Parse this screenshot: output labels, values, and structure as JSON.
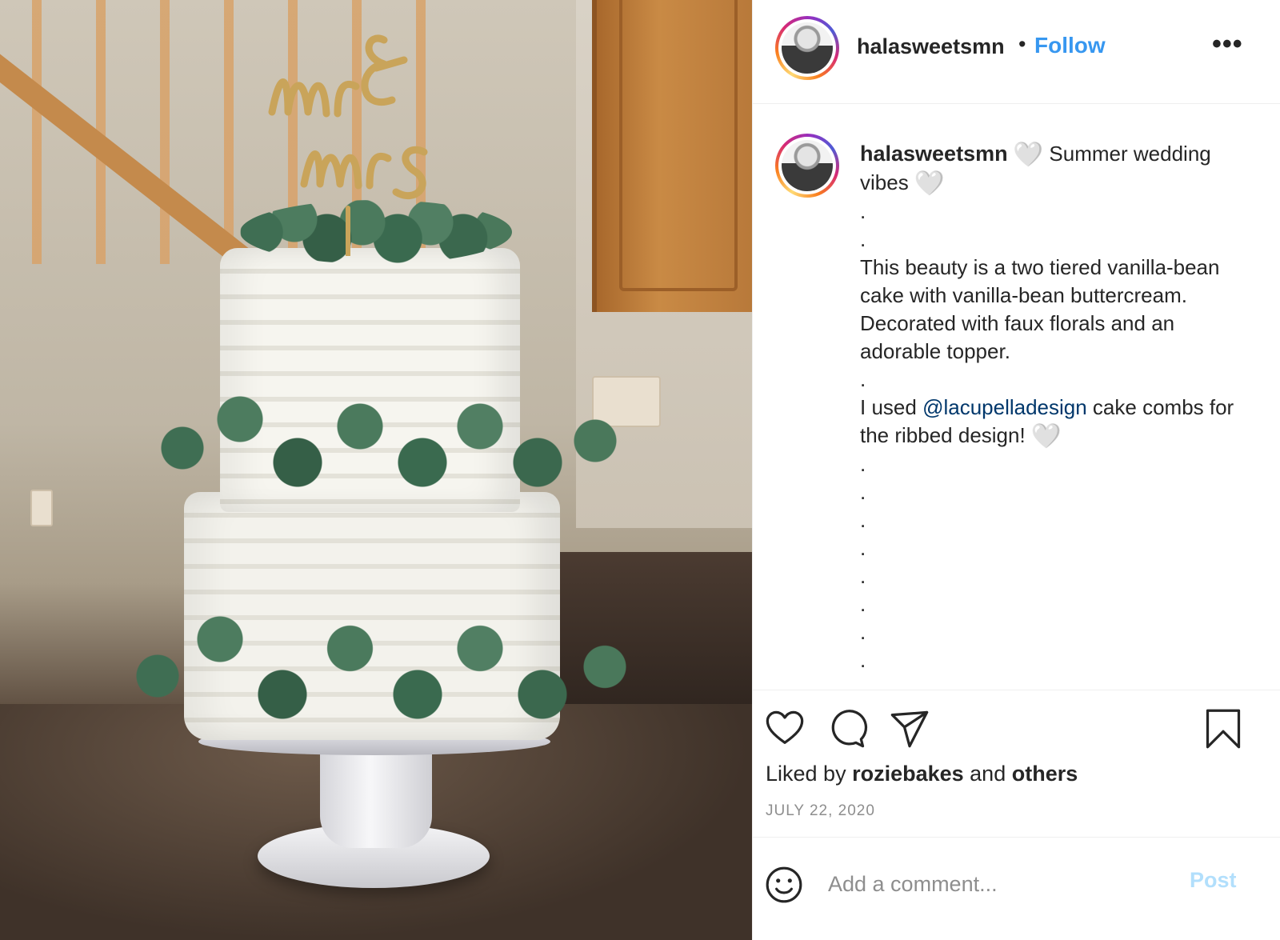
{
  "post": {
    "username": "halasweetsmn",
    "follow_label": "Follow",
    "separator": "•",
    "more_label": "•••"
  },
  "caption": {
    "username": "halasweetsmn",
    "heart": "🤍",
    "line1": "Summer wedding vibes",
    "dots_a": [
      ".",
      "."
    ],
    "paragraph1": "This beauty is a two tiered vanilla-bean cake with vanilla-bean buttercream. Decorated with faux florals and an adorable topper.",
    "dot_b": ".",
    "p2_before": "I used ",
    "mention": "@lacupelladesign",
    "p2_after": " cake combs for the ribbed design!",
    "dots_c": [
      ".",
      ".",
      ".",
      ".",
      ".",
      ".",
      ".",
      "."
    ]
  },
  "actions": {
    "icons": [
      "heart-icon",
      "comment-icon",
      "share-icon",
      "bookmark-icon"
    ]
  },
  "likes": {
    "prefix": "Liked by ",
    "user": "roziebakes",
    "middle": " and ",
    "others": "others"
  },
  "date": "JULY 22, 2020",
  "comment": {
    "placeholder": "Add a comment...",
    "post_label": "Post"
  },
  "colors": {
    "follow": "#3797f0",
    "mention": "#00376b",
    "post_disabled": "#b2dffc",
    "muted": "#8e8e8e"
  },
  "photo": {
    "topper_text": "Mr & Mrs"
  }
}
